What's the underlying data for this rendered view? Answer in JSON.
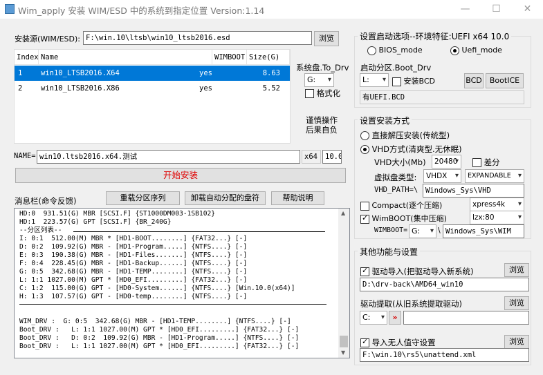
{
  "window": {
    "title": "Wim_apply 安装 WIM/ESD 中的系统到指定位置 Version:1.14",
    "minimize": "—",
    "maximize": "☐",
    "close": "✕"
  },
  "source": {
    "label": "安装源(WIM/ESD):",
    "path": "F:\\win.10\\ltsb\\win10_ltsb2016.esd",
    "browse": "浏览"
  },
  "table": {
    "headers": [
      "Index",
      "Name",
      "WIMBOOT",
      "Size(G)"
    ],
    "rows": [
      {
        "index": "1",
        "name": "win10_LTSB2016.X64",
        "wimboot": "yes",
        "size": "8.63"
      },
      {
        "index": "2",
        "name": "win10_LTSB2016.X86",
        "wimboot": "yes",
        "size": "5.52"
      }
    ]
  },
  "target": {
    "label": "系统盘.To_Drv",
    "drive": "G:",
    "format_label": "格式化",
    "careful_line1": "谨慎操作",
    "careful_line2": "后果自负"
  },
  "name_field": {
    "label": "NAME=",
    "value": "win10.ltsb2016.x64.测试",
    "arch": "x64",
    "version": "10.0"
  },
  "start_button": "开始安装",
  "console_header": {
    "label": "消息栏(命令反馈)",
    "btn_rescan": "重载分区序列",
    "btn_unmount": "卸载自动分配的盘符",
    "btn_help": "帮助说明"
  },
  "console_lines": {
    "disk0": "HD:0  931.51(G) MBR [SCSI.F] {ST1000DM003-1SB102}",
    "disk1": "HD:1  223.57(G) GPT [SCSI.F] {BR_240G}",
    "parts_title": "--分区列表--",
    "p1": "I: 0:1  512.00(M) MBR * [HD1-BOOT........] {FAT32...} [-]",
    "p2": "D: 0:2  109.92(G) MBR - [HD1-Program.....] {NTFS....} [-]",
    "p3": "E: 0:3  190.38(G) MBR - [HD1-Files.......] {NTFS....} [-]",
    "p4": "F: 0:4  228.45(G) MBR - [HD1-Backup......] {NTFS....} [-]",
    "p5": "G: 0:5  342.68(G) MBR - [HD1-TEMP........] {NTFS....} [-]",
    "p6": "L: 1:1 1027.00(M) GPT * [HD0_EFI.........] {FAT32...} [-]",
    "p7": "C: 1:2  115.00(G) GPT - [HD0-System......] {NTFS....} [Win.10.0(x64)]",
    "p8": "H: 1:3  107.57(G) GPT - [HD0-temp........] {NTFS....} [-]",
    "w1": "WIM_DRV :  G: 0:5  342.68(G) MBR - [HD1-TEMP........] {NTFS....} [-]",
    "w2": "Boot_DRV :   L: 1:1 1027.00(M) GPT * [HD0_EFI.........] {FAT32...} [-]",
    "w3": "Boot_DRV :   D: 0:2  109.92(G) MBR - [HD1-Program.....] {NTFS....} [-]",
    "w4": "Boot_DRV :   L: 1:1 1027.00(M) GPT * [HD0_EFI.........] {FAT32...} [-]"
  },
  "boot_group": {
    "title": "设置启动选项--环境特征:UEFI x64 10.0",
    "bios_mode": "BIOS_mode",
    "uefi_mode": "Uefi_mode",
    "boot_drv_label": "启动分区.Boot_Drv",
    "boot_drv": "L:",
    "install_bcd": "安装BCD",
    "bcd_button": "BCD",
    "bootice_button": "BootICE",
    "status": "有UEFI.BCD"
  },
  "install_group": {
    "title": "设置安装方式",
    "direct": "直接解压安装(传统型)",
    "vhd": "VHD方式(清爽型.无休眠)",
    "vhd_size_label": "VHD大小(Mb)",
    "vhd_size": "20480",
    "diff_label": "差分",
    "vdisk_type_label": "虚拟盘类型:",
    "vdisk_type": "VHDX",
    "expand_type": "EXPANDABLE",
    "vhd_path_label": "VHD_PATH=\\",
    "vhd_path": "Windows_Sys\\VHD",
    "compact_label": "Compact(逐个压缩)",
    "compact_algo": "xpress4k",
    "wimboot_label": "WimBOOT(集中压缩)",
    "wimboot_algo": "lzx:80",
    "wimboot_eq": "WIMBOOT=",
    "wimboot_drive": "G:",
    "wimboot_sep": "\\",
    "wimboot_path": "Windows_Sys\\WIM"
  },
  "other_group": {
    "title": "其他功能与设置",
    "driver_import": "驱动导入(把驱动导入新系统)",
    "driver_import_browse": "浏览",
    "driver_import_path": "D:\\drv-back\\AMD64_win10",
    "driver_extract": "驱动提取(从旧系统提取驱动)",
    "driver_extract_browse": "浏览",
    "driver_extract_drive": "C:",
    "driver_extract_go": "»",
    "unattend": "导入无人值守设置",
    "unattend_browse": "浏览",
    "unattend_path": "F:\\win.10\\rs5\\unattend.xml"
  },
  "colors": {
    "selection": "#0078d7",
    "start_text": "#e00000",
    "go_red": "#d40000"
  }
}
